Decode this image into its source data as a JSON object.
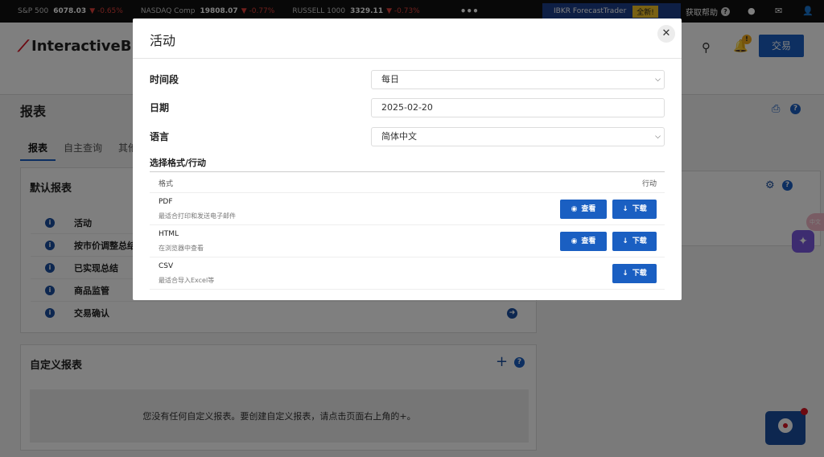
{
  "ticker": {
    "items": [
      {
        "name": "S&P 500",
        "value": "6078.03",
        "change": "-0.65%"
      },
      {
        "name": "NASDAQ Comp",
        "value": "19808.07",
        "change": "-0.77%"
      },
      {
        "name": "RUSSELL 1000",
        "value": "3329.11",
        "change": "-0.73%"
      }
    ],
    "more": "•••",
    "forecast_label": "IBKR ForecastTrader",
    "new_badge": "全新!",
    "help_label": "获取帮助"
  },
  "header": {
    "logo_text": "InteractiveBrok",
    "bell_badge": "!",
    "trade_label": "交易"
  },
  "page": {
    "title": "报表",
    "tabs": [
      {
        "label": "报表",
        "active": true
      },
      {
        "label": "自主查询",
        "active": false
      },
      {
        "label": "其他",
        "active": false
      }
    ]
  },
  "default_reports": {
    "title": "默认报表",
    "items": [
      {
        "label": "活动"
      },
      {
        "label": "按市价调整总结"
      },
      {
        "label": "已实现总结"
      },
      {
        "label": "商品监管"
      },
      {
        "label": "交易确认"
      }
    ]
  },
  "custom_reports": {
    "title": "自定义报表",
    "empty_text": "您没有任何自定义报表。要创建自定义报表，请点击页面右上角的+。"
  },
  "side_pill": "中文",
  "modal": {
    "title": "活动",
    "close": "✕",
    "fields": {
      "period_label": "时间段",
      "period_value": "每日",
      "date_label": "日期",
      "date_value": "2025-02-20",
      "lang_label": "语言",
      "lang_value": "简体中文"
    },
    "section_title": "选择格式/行动",
    "col_format": "格式",
    "col_action": "行动",
    "view_label": "查看",
    "download_label": "下载",
    "formats": [
      {
        "name": "PDF",
        "desc": "最适合打印和发送电子邮件"
      },
      {
        "name": "HTML",
        "desc": "在浏览器中查看"
      },
      {
        "name": "CSV",
        "desc": "最适合导入Excel等"
      }
    ]
  },
  "colors": {
    "accent": "#1a5fc2",
    "ticker_down": "#e0413a",
    "brand_red": "#d81222"
  }
}
